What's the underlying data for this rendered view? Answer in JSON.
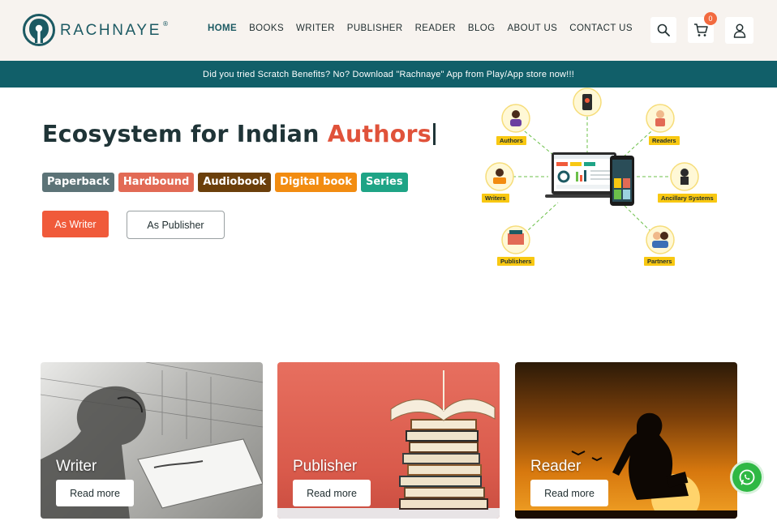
{
  "brand": {
    "name": "RACHNAYE",
    "reg": "®",
    "teal": "#115f69",
    "orange": "#f05a3a"
  },
  "nav": {
    "items": [
      {
        "label": "HOME",
        "active": true
      },
      {
        "label": "BOOKS"
      },
      {
        "label": "WRITER"
      },
      {
        "label": "PUBLISHER"
      },
      {
        "label": "READER"
      },
      {
        "label": "BLOG"
      },
      {
        "label": "ABOUT US"
      },
      {
        "label": "CONTACT US"
      }
    ]
  },
  "header_actions": {
    "search_icon": "search-icon",
    "cart_icon": "cart-icon",
    "cart_count": "0",
    "user_icon": "user-icon"
  },
  "announcement": "Did you tried Scratch Benefits? No? Download \"Rachnaye\" App from Play/App store now!!!",
  "hero": {
    "title_prefix": "Ecosystem for Indian ",
    "title_accent": "Authors",
    "tags": [
      {
        "label": "Paperback",
        "color": "#5c7377"
      },
      {
        "label": "Hardbound",
        "color": "#e26a55"
      },
      {
        "label": "Audiobook",
        "color": "#6b3f0b"
      },
      {
        "label": "Digital book",
        "color": "#f28c11"
      },
      {
        "label": "Series",
        "color": "#1ea486"
      }
    ],
    "btn_writer": "As Writer",
    "btn_publisher": "As Publisher"
  },
  "ecosystem": {
    "labels": [
      "Authors",
      "Readers",
      "Writers",
      "Ancillary Systems",
      "Publishers",
      "Partners"
    ]
  },
  "cards": [
    {
      "title": "Writer",
      "button": "Read more"
    },
    {
      "title": "Publisher",
      "button": "Read more"
    },
    {
      "title": "Reader",
      "button": "Read more"
    }
  ],
  "floating": {
    "whatsapp_icon": "whatsapp-icon"
  }
}
